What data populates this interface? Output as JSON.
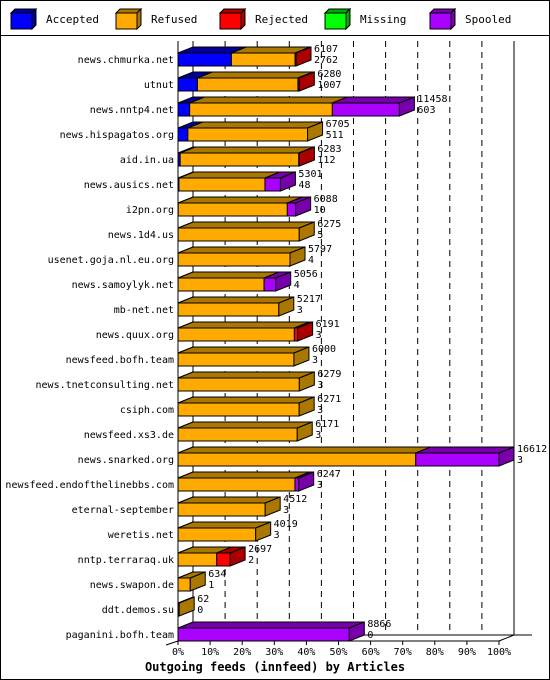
{
  "legend": [
    {
      "label": "Accepted",
      "color": "#0000ff",
      "side": "#000099"
    },
    {
      "label": "Refused",
      "color": "#ffaa00",
      "side": "#aa7700"
    },
    {
      "label": "Rejected",
      "color": "#ff0000",
      "side": "#aa0000"
    },
    {
      "label": "Missing",
      "color": "#00ff00",
      "side": "#00aa00"
    },
    {
      "label": "Spooled",
      "color": "#aa00ff",
      "side": "#7700aa"
    }
  ],
  "chart_data": {
    "type": "bar",
    "orientation": "horizontal",
    "stacked": true,
    "title": "Outgoing feeds (innfeed) by Articles",
    "xlabel": "Outgoing feeds (innfeed) by Articles",
    "x_ticks": [
      "0%",
      "10%",
      "20%",
      "30%",
      "40%",
      "50%",
      "60%",
      "70%",
      "80%",
      "90%",
      "100%"
    ],
    "xlim": [
      0,
      100
    ],
    "max_total": 16612,
    "grid": true,
    "legend_position": "top",
    "series_names": [
      "Accepted",
      "Refused",
      "Rejected",
      "Missing",
      "Spooled"
    ],
    "categories": [
      "news.chmurka.net",
      "utnut",
      "news.nntp4.net",
      "news.hispagatos.org",
      "aid.in.ua",
      "news.ausics.net",
      "i2pn.org",
      "news.1d4.us",
      "usenet.goja.nl.eu.org",
      "news.samoylyk.net",
      "mb-net.net",
      "news.quux.org",
      "newsfeed.bofh.team",
      "news.tnetconsulting.net",
      "csiph.com",
      "newsfeed.xs3.de",
      "news.snarked.org",
      "newsfeed.endofthelinebbs.com",
      "eternal-september",
      "weretis.net",
      "nntp.terraraq.uk",
      "news.swapon.de",
      "ddt.demos.su",
      "paganini.bofh.team"
    ],
    "totals": [
      6107,
      6280,
      11458,
      6705,
      6283,
      5301,
      6088,
      6275,
      5797,
      5056,
      5217,
      6191,
      6000,
      6279,
      6271,
      6171,
      16612,
      6247,
      4512,
      4019,
      2697,
      634,
      62,
      8866
    ],
    "accepted": [
      2762,
      1007,
      603,
      511,
      112,
      48,
      10,
      5,
      4,
      4,
      3,
      3,
      3,
      3,
      3,
      3,
      3,
      3,
      3,
      3,
      2,
      1,
      0,
      0
    ],
    "series": [
      {
        "name": "Accepted",
        "values": [
          2762,
          1007,
          603,
          511,
          112,
          48,
          10,
          5,
          4,
          4,
          3,
          3,
          3,
          3,
          3,
          3,
          3,
          3,
          3,
          3,
          2,
          1,
          0,
          0
        ]
      },
      {
        "name": "Refused",
        "values": [
          3300,
          5200,
          7385,
          6194,
          6140,
          4453,
          5648,
          6270,
          5793,
          4452,
          5214,
          6020,
          5997,
          6276,
          6268,
          6168,
          12300,
          6050,
          4509,
          4016,
          2000,
          633,
          62,
          0
        ]
      },
      {
        "name": "Rejected",
        "values": [
          45,
          73,
          0,
          0,
          31,
          0,
          0,
          0,
          0,
          0,
          0,
          168,
          0,
          0,
          0,
          0,
          0,
          0,
          0,
          0,
          695,
          0,
          0,
          0
        ]
      },
      {
        "name": "Missing",
        "values": [
          0,
          0,
          0,
          0,
          0,
          0,
          0,
          0,
          0,
          0,
          0,
          0,
          0,
          0,
          0,
          0,
          0,
          0,
          0,
          0,
          0,
          0,
          0,
          0
        ]
      },
      {
        "name": "Spooled",
        "values": [
          0,
          0,
          3470,
          0,
          0,
          800,
          430,
          0,
          0,
          600,
          0,
          0,
          0,
          0,
          0,
          0,
          4309,
          194,
          0,
          0,
          0,
          0,
          0,
          8866
        ]
      }
    ]
  }
}
